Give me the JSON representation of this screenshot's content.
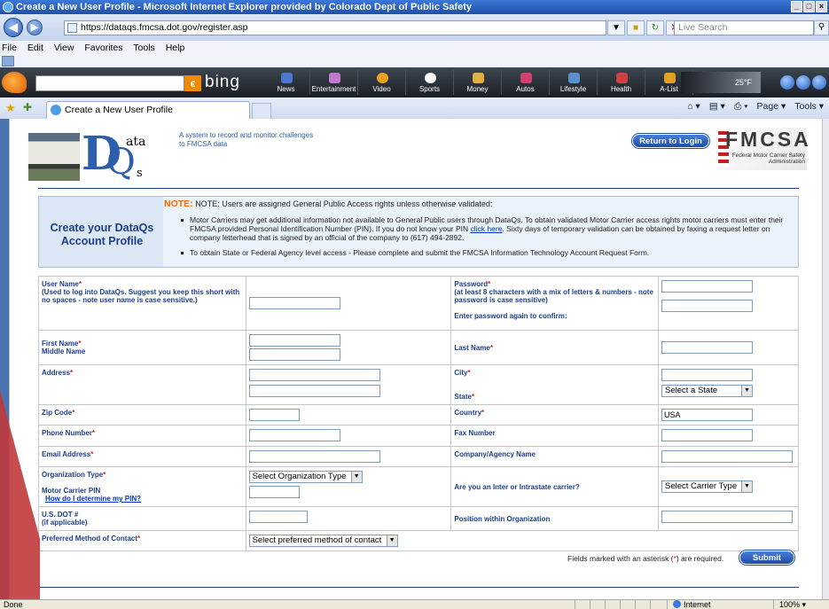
{
  "window": {
    "title": "Create a New User Profile - Microsoft Internet Explorer provided by Colorado Dept of Public Safety",
    "controls": [
      "_",
      "□",
      "×"
    ]
  },
  "addressbar": {
    "url": "https://dataqs.fmcsa.dot.gov/register.asp",
    "search_placeholder": "Live Search"
  },
  "menu": [
    "File",
    "Edit",
    "View",
    "Favorites",
    "Tools",
    "Help"
  ],
  "bing": {
    "logo": "bing",
    "tabs": [
      "News",
      "Entertainment",
      "Video",
      "Sports",
      "Money",
      "Autos",
      "Lifestyle",
      "Health",
      "A-List"
    ],
    "weather": "25°F"
  },
  "tabs": {
    "active": "Create a New User Profile"
  },
  "commandbar": {
    "page": "Page",
    "tools": "Tools"
  },
  "header": {
    "logo_letters": {
      "d": "D",
      "ata": "ata",
      "q": "Q",
      "s": "s"
    },
    "tagline": "A system to record and monitor challenges to FMCSA data",
    "return_button": "Return to Login",
    "agency_abbr": "FMCSA",
    "agency_name": "Federal Motor Carrier Safety Administration"
  },
  "notice": {
    "title": "Create your DataQs Account Profile",
    "note_label": "NOTE:",
    "note_text": "NOTE: Users are assigned General Public Access rights unless otherwise validated:",
    "bullet1_a": "Motor Carriers may get additional information not available to General Public users through DataQs. To obtain validated Motor Carrier access rights motor carriers must enter their FMCSA provided Personal Identification Number (PIN). If you do not know your PIN ",
    "bullet1_link": "click here",
    "bullet1_b": ". Sixty days of temporary validation can be obtained by faxing a request letter on company letterhead that is signed by an official of the company to (617) 494-2892.",
    "bullet2": "To obtain State or Federal Agency level access - Please complete and submit the FMCSA Information Technology Account Request Form."
  },
  "form": {
    "asterisk": "*",
    "username_label": "User Name",
    "username_hint": "(Used to log into DataQs. Suggest you keep this short with no spaces - note user name is case sensitive.)",
    "password_label": "Password",
    "password_hint": "(at least 8 characters with a mix of letters & numbers - note password is case sensitive)",
    "password_confirm": "Enter password again to confirm:",
    "first_name": "First Name",
    "middle_name": "Middle Name",
    "last_name": "Last Name",
    "address": "Address",
    "city": "City",
    "state": "State",
    "state_select": "Select a State",
    "zip": "Zip Code",
    "country": "Country",
    "country_value": "USA",
    "phone": "Phone Number",
    "fax": "Fax Number",
    "email": "Email Address",
    "company": "Company/Agency Name",
    "org_type": "Organization Type",
    "org_type_select": "Select Organization Type",
    "pin_label": "Motor Carrier PIN",
    "pin_link": "How do I determine my PIN?",
    "carrier_q": "Are you an Inter or Intrastate carrier?",
    "carrier_select": "Select Carrier Type",
    "usdot": "U.S. DOT #",
    "usdot_hint": "(if applicable)",
    "position": "Position within Organization",
    "contact": "Preferred Method of Contact",
    "contact_select": "Select preferred method of contact"
  },
  "footer": {
    "required_a": "Fields marked with an asterisk (",
    "required_star": "*",
    "required_b": ") are required.",
    "submit": "Submit"
  },
  "status": {
    "text": "Done",
    "zone": "Internet",
    "zoom": "100%"
  }
}
